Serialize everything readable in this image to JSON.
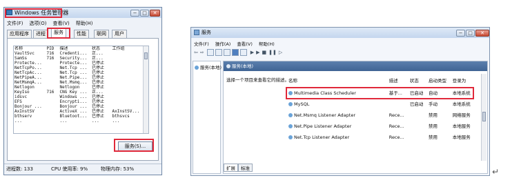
{
  "task_manager": {
    "title": "Windows 任务管理器",
    "menu": [
      "文件(F)",
      "选项(O)",
      "查看(V)",
      "帮助(H)"
    ],
    "tabs": [
      "应用程序",
      "进程",
      "服务",
      "性能",
      "联网",
      "用户"
    ],
    "active_tab": "服务",
    "columns": [
      "名称",
      "PID",
      "描述",
      "状态",
      "工作组"
    ],
    "rows": [
      [
        "VaultSvc",
        "716",
        "Credenti...",
        "正...",
        ""
      ],
      [
        "SamSs",
        "716",
        "Security...",
        "正...",
        ""
      ],
      [
        "Protecte...",
        "",
        "Protecte...",
        "已停止",
        ""
      ],
      [
        "NetTcpPo...",
        "",
        "Net.Tcp ...",
        "已停止",
        ""
      ],
      [
        "NetTcpAc...",
        "",
        "Net.Tcp ...",
        "已停止",
        ""
      ],
      [
        "NetPipeA...",
        "",
        "Net.Pipe...",
        "已停止",
        ""
      ],
      [
        "NetMsmqA...",
        "",
        "Net.Msmq...",
        "已停止",
        ""
      ],
      [
        "Netlogon",
        "",
        "Netlogon",
        "已停止",
        ""
      ],
      [
        "KeyIso",
        "716",
        "CNG Key ...",
        "正...",
        ""
      ],
      [
        "idsvc",
        "",
        "Windows ...",
        "已停止",
        ""
      ],
      [
        "EFS",
        "",
        "Encrypti...",
        "已停止",
        ""
      ],
      [
        "Bonjour ...",
        "",
        "Bonjour ...",
        "已停止",
        ""
      ],
      [
        "AxInstSV",
        "",
        "ActiveX ...",
        "已停止",
        "AxInstSV..."
      ],
      [
        "bthserv",
        "",
        "Bluetoot...",
        "已停止",
        "bthsvcs"
      ],
      [
        "...",
        "",
        "...",
        "...",
        "..."
      ]
    ],
    "services_button": "服务(S)...",
    "status": {
      "processes": "进程数: 133",
      "cpu": "CPU 使用率: 9%",
      "memory": "物理内存: 53%"
    },
    "controls": [
      "minimize",
      "maximize",
      "close"
    ]
  },
  "services_window": {
    "title": "服务",
    "menu": [
      "文件(F)",
      "操作(A)",
      "查看(V)",
      "帮助(H)"
    ],
    "left_tree_item": "服务(本地)",
    "header_title": "服务(本地)",
    "side_hint": "选择一个项目来查看它的描述。",
    "columns": [
      "名称",
      "描述",
      "状态",
      "启动类型",
      "登录为"
    ],
    "rows": [
      {
        "name": "Multimedia Class Scheduler",
        "desc": "基于...",
        "status": "已启动",
        "startup": "自动",
        "logon": "本地系统"
      },
      {
        "name": "MySQL",
        "desc": "",
        "status": "已启动",
        "startup": "手动",
        "logon": "本地系统"
      },
      {
        "name": "Net.Msmq Listener Adapter",
        "desc": "Rece...",
        "status": "",
        "startup": "禁用",
        "logon": "网络服务"
      },
      {
        "name": "Net.Pipe Listener Adapter",
        "desc": "Rece...",
        "status": "",
        "startup": "禁用",
        "logon": "本地服务"
      },
      {
        "name": "Net.Tcp Listener Adapter",
        "desc": "Rece...",
        "status": "",
        "startup": "禁用",
        "logon": "本地服务"
      }
    ],
    "bottom_tabs": [
      "扩展",
      "标准"
    ],
    "highlighted_row": "MySQL"
  },
  "colors": {
    "highlight_border": "#e0283a",
    "title_bar": "#c9daf0"
  },
  "paragraph_mark": "↵"
}
